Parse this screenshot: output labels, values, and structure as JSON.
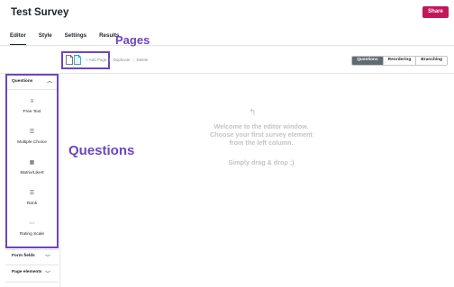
{
  "header": {
    "title": "Test Survey",
    "share_label": "Share"
  },
  "tabs": [
    {
      "label": "Editor",
      "active": true
    },
    {
      "label": "Style"
    },
    {
      "label": "Settings"
    },
    {
      "label": "Results"
    }
  ],
  "annotations": {
    "pages": "Pages",
    "questions": "Questions"
  },
  "page_toolbar": {
    "add_page": "+ Add Page",
    "duplicate": "Duplicate",
    "delete": "Delete"
  },
  "view_toggle": {
    "items": [
      "Questions",
      "Reordering",
      "Branching"
    ],
    "active": "Questions"
  },
  "sidebar": {
    "questions_header": "Questions",
    "items": [
      {
        "label": "Free Text",
        "icon": "free-text-icon"
      },
      {
        "label": "Multiple Choice",
        "icon": "multiple-choice-icon"
      },
      {
        "label": "Matrix/Likert",
        "icon": "matrix-icon"
      },
      {
        "label": "Rank",
        "icon": "rank-icon"
      },
      {
        "label": "Rating Scale",
        "icon": "rating-scale-icon"
      }
    ],
    "form_fields_header": "Form fields",
    "page_elements_header": "Page elements"
  },
  "empty_state": {
    "line1": "Welcome to the editor window.",
    "line2": "Choose your first survey element",
    "line3": "from the left column.",
    "hint": "Simply drag & drop ;)"
  },
  "colors": {
    "accent": "#6b46c1",
    "share": "#c2185b",
    "doc_icon": "#29a3d1"
  }
}
